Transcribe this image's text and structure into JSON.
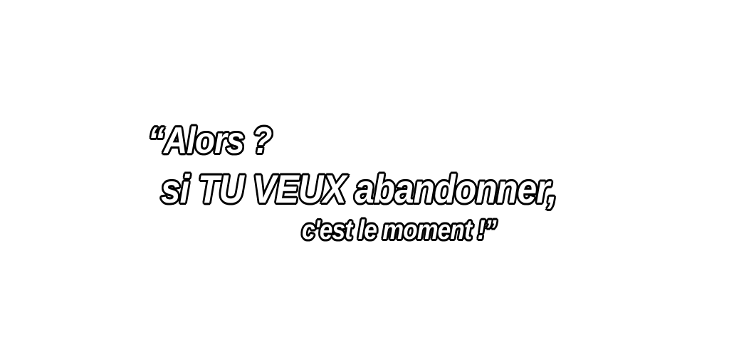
{
  "speech": {
    "line1": "“Alors ?",
    "line2": "si TU VEUX abandonner,",
    "line3": "c'est le moment !”"
  },
  "colors": {
    "background": "#ffffff",
    "text_fill": "#ffffff",
    "text_outline": "#000000"
  }
}
